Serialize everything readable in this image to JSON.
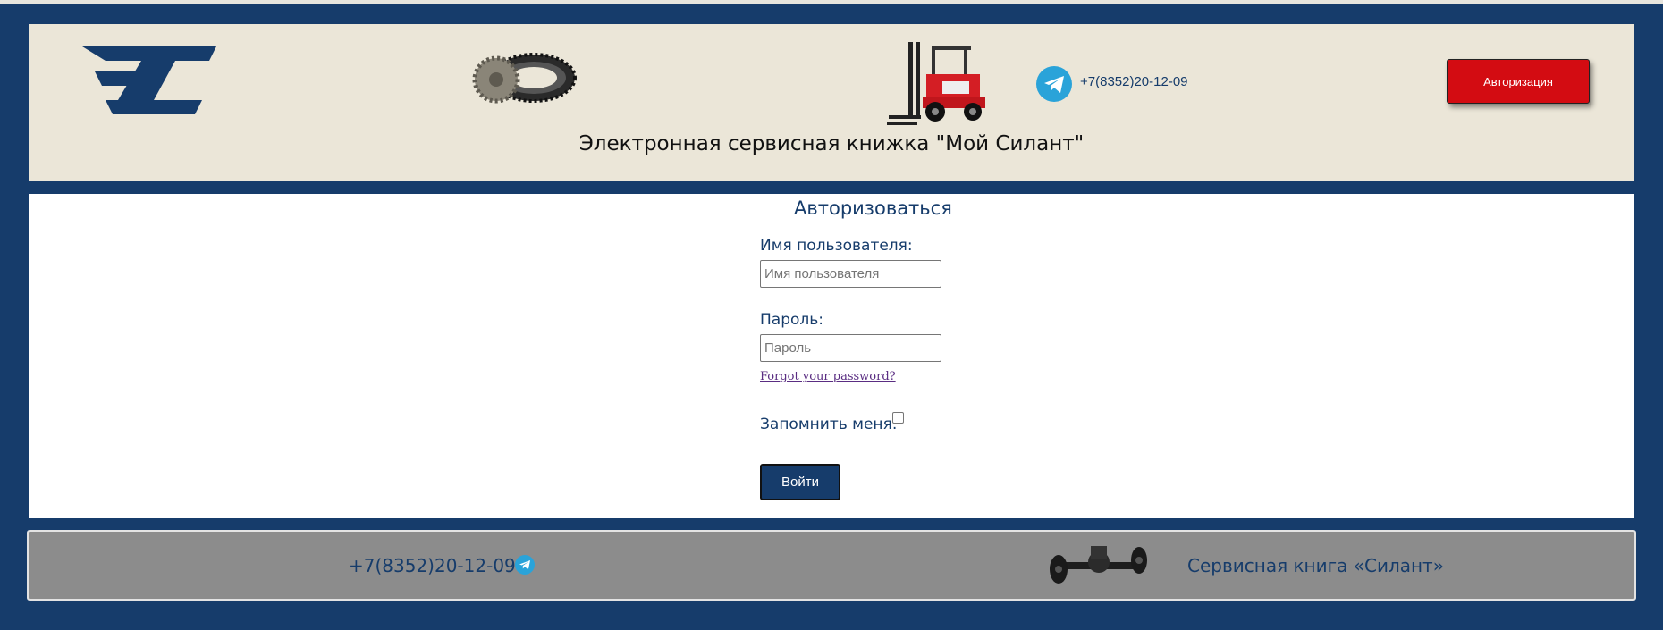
{
  "header": {
    "phone": "+7(8352)20-12-09",
    "auth_button": "Авторизация",
    "title": "Электронная сервисная книжка \"Мой Силант\"",
    "icons": [
      "silant-logo-icon",
      "gear-icon",
      "forklift-icon",
      "telegram-icon"
    ]
  },
  "login": {
    "title": "Авторизоваться",
    "username_label": "Имя пользователя:",
    "username_placeholder": "Имя пользователя",
    "username_value": "",
    "password_label": "Пароль:",
    "password_placeholder": "Пароль",
    "password_value": "",
    "forgot_link": "Forgot your password?",
    "remember_label": "Запомнить меня:",
    "remember_checked": false,
    "submit_button": "Войти"
  },
  "footer": {
    "phone": "+7(8352)20-12-09",
    "brand": "Сервисная книга «Силант»",
    "icons": [
      "telegram-icon",
      "axle-icon"
    ]
  },
  "colors": {
    "page_background": "#163c6b",
    "header_background": "#ebe6d8",
    "accent_red": "#d30c12",
    "footer_background": "#8c8c8c",
    "text_blue": "#163c6b"
  }
}
